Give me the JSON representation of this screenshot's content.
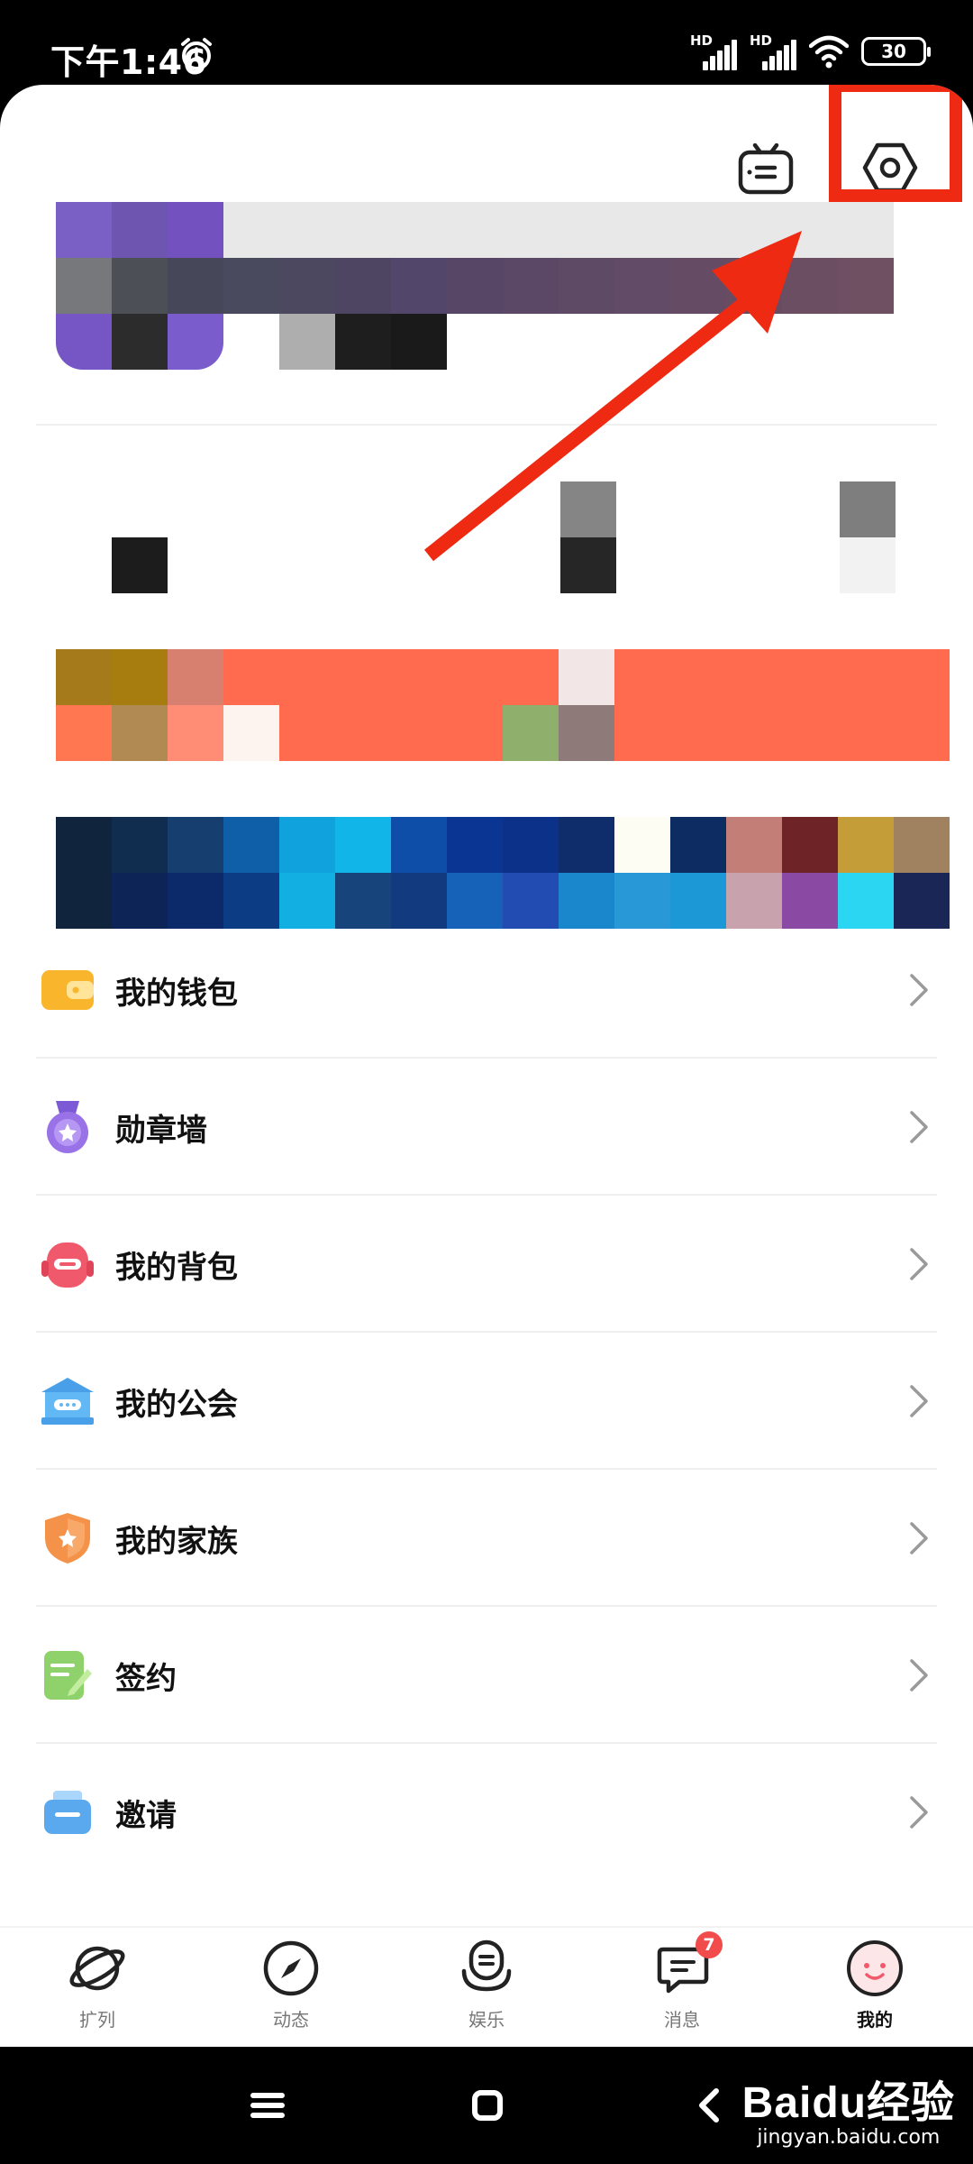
{
  "status_bar": {
    "time": "下午1:46",
    "battery": "30",
    "network_label_1": "HD",
    "network_label_2": "HD"
  },
  "colors": {
    "accent_red": "#ee2b12",
    "badge_red": "#f24b4b",
    "wallet_yellow": "#f9b52b",
    "medal_purple": "#9a72e8",
    "backpack_pink": "#f0596b",
    "guild_blue": "#62b8f5",
    "family_orange": "#f5924a",
    "sign_green": "#8fd16a",
    "invite_blue": "#5aa9ee"
  },
  "top_icons": {
    "robot": "robot-icon",
    "settings": "settings-hexagon-icon"
  },
  "menu": {
    "items": [
      {
        "label": "我的钱包",
        "icon": "wallet-icon"
      },
      {
        "label": "勋章墙",
        "icon": "medal-icon"
      },
      {
        "label": "我的背包",
        "icon": "backpack-icon"
      },
      {
        "label": "我的公会",
        "icon": "guild-icon"
      },
      {
        "label": "我的家族",
        "icon": "family-shield-icon"
      },
      {
        "label": "签约",
        "icon": "sign-contract-icon"
      },
      {
        "label": "邀请",
        "icon": "invite-icon"
      }
    ]
  },
  "bottom_nav": {
    "items": [
      {
        "label": "扩列",
        "icon": "planet-icon"
      },
      {
        "label": "动态",
        "icon": "compass-icon"
      },
      {
        "label": "娱乐",
        "icon": "microphone-icon"
      },
      {
        "label": "消息",
        "icon": "message-icon",
        "badge": "7"
      },
      {
        "label": "我的",
        "icon": "profile-face-icon",
        "active": true
      }
    ]
  },
  "watermark": {
    "logo": "Baidu经验",
    "url": "jingyan.baidu.com"
  }
}
